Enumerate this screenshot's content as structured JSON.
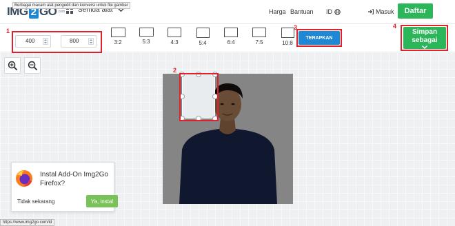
{
  "nav": {
    "logo_left": "IMG",
    "logo_mid": "2",
    "logo_right": "GO",
    "logo_small": ".com",
    "tools_label": "Semua alat",
    "pricing": "Harga",
    "help": "Bantuan",
    "language": "ID",
    "signin": "Masuk",
    "signup": "Daftar"
  },
  "toolbar": {
    "tooltip": "Berbagai macam alat pengedit dan konversi untuk file gambar",
    "width_value": "400",
    "height_value": "800",
    "ratios": [
      {
        "label": "3:2"
      },
      {
        "label": "5:3"
      },
      {
        "label": "4:3"
      },
      {
        "label": "5:4"
      },
      {
        "label": "6:4"
      },
      {
        "label": "7:5"
      },
      {
        "label": "10:8"
      }
    ],
    "apply_label": "TERAPKAN",
    "save_line1": "Simpan",
    "save_line2": "sebagai"
  },
  "annotations": {
    "n1": "1",
    "n2": "2",
    "n3": "3",
    "n4": "4"
  },
  "addon": {
    "title": "Instal Add-On Img2Go Firefox?",
    "later": "Tidak sekarang",
    "install": "Ya, instal"
  },
  "status_url": "https://www.img2go.com/id",
  "colors": {
    "brand_blue": "#1e88d6",
    "green": "#2bb65a",
    "annotation_red": "#e0212b"
  }
}
